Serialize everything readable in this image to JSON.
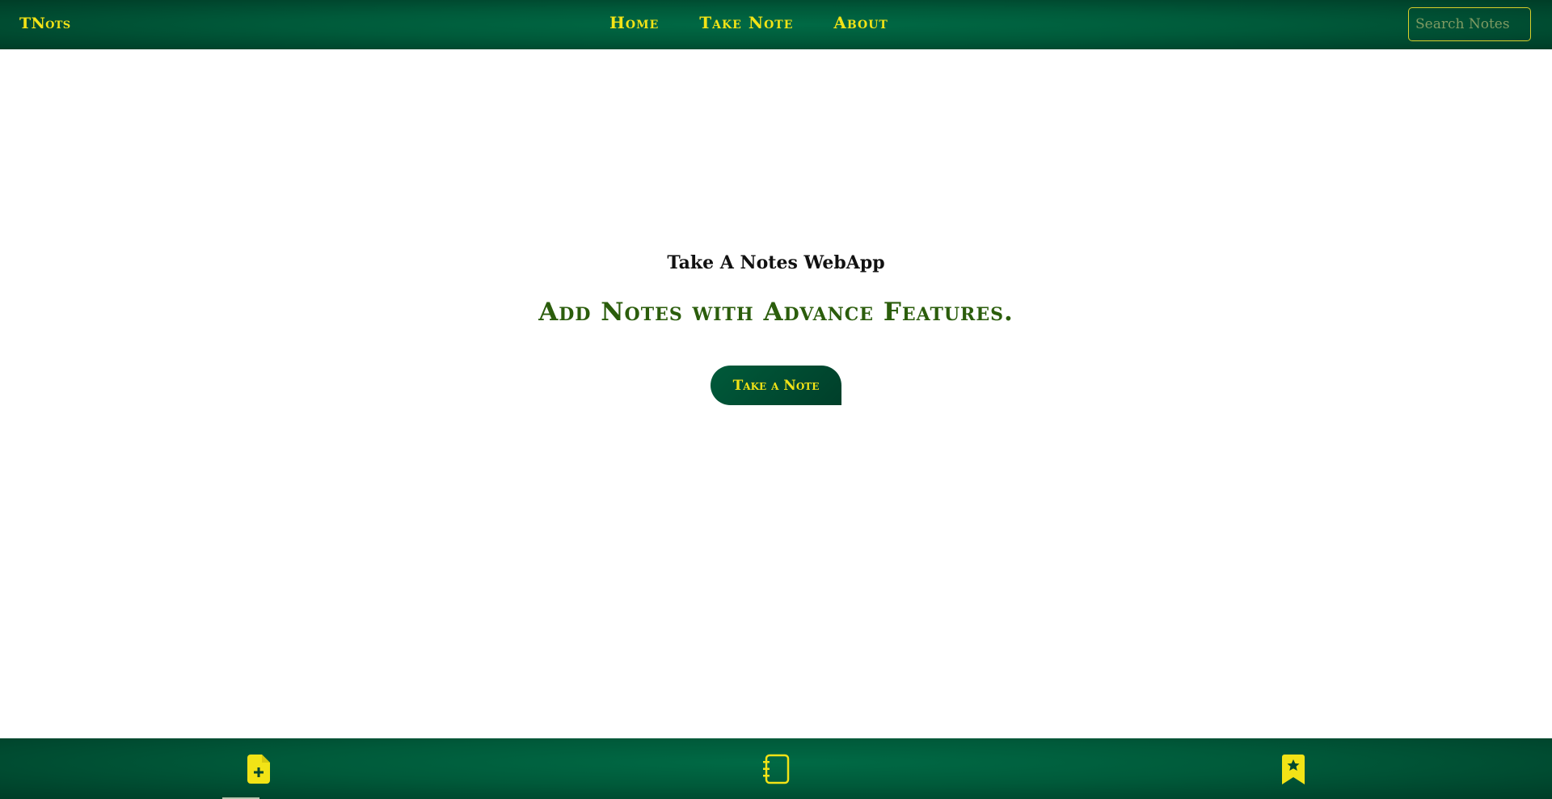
{
  "header": {
    "brand": "TNots",
    "nav": [
      {
        "label": "Home"
      },
      {
        "label": "Take Note"
      },
      {
        "label": "About"
      }
    ],
    "search_placeholder": "Search Notes"
  },
  "hero": {
    "subtitle": "Take A Notes WebApp",
    "headline": "Add Notes with Advance Features.",
    "cta_label": "Take a Note"
  },
  "bottom_nav": {
    "items": [
      {
        "icon": "file-add-icon"
      },
      {
        "icon": "notebook-icon"
      },
      {
        "icon": "bookmark-star-icon"
      }
    ]
  },
  "colors": {
    "brand_green": "#005a3a",
    "accent_yellow": "#f2e316",
    "headline_green": "#2b5d0c"
  }
}
